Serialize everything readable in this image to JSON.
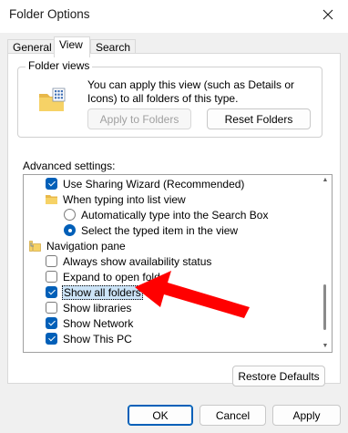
{
  "window": {
    "title": "Folder Options",
    "close_icon": "close-icon"
  },
  "tabs": [
    {
      "label": "General",
      "active": false
    },
    {
      "label": "View",
      "active": true
    },
    {
      "label": "Search",
      "active": false
    }
  ],
  "folder_views": {
    "group_title": "Folder views",
    "description": "You can apply this view (such as Details or Icons) to all folders of this type.",
    "apply_button": "Apply to Folders",
    "reset_button": "Reset Folders"
  },
  "advanced": {
    "label": "Advanced settings:",
    "items": [
      {
        "type": "checkbox",
        "label": "Use Sharing Wizard (Recommended)",
        "checked": true,
        "indent": 1
      },
      {
        "type": "folder",
        "label": "When typing into list view",
        "indent": 1
      },
      {
        "type": "radio",
        "label": "Automatically type into the Search Box",
        "checked": false,
        "indent": 2
      },
      {
        "type": "radio",
        "label": "Select the typed item in the view",
        "checked": true,
        "indent": 2
      },
      {
        "type": "nav",
        "label": "Navigation pane",
        "indent": 0
      },
      {
        "type": "checkbox",
        "label": "Always show availability status",
        "checked": false,
        "indent": 1
      },
      {
        "type": "checkbox",
        "label": "Expand to open folder",
        "checked": false,
        "indent": 1
      },
      {
        "type": "checkbox",
        "label": "Show all folders",
        "checked": true,
        "indent": 1,
        "selected": true
      },
      {
        "type": "checkbox",
        "label": "Show libraries",
        "checked": false,
        "indent": 1
      },
      {
        "type": "checkbox",
        "label": "Show Network",
        "checked": true,
        "indent": 1
      },
      {
        "type": "checkbox",
        "label": "Show This PC",
        "checked": true,
        "indent": 1
      }
    ]
  },
  "restore_button": "Restore Defaults",
  "footer": {
    "ok": "OK",
    "cancel": "Cancel",
    "apply": "Apply"
  },
  "colors": {
    "accent": "#005fb8",
    "annotation": "#ff0000",
    "dialog_bg": "#f0f0f0"
  }
}
